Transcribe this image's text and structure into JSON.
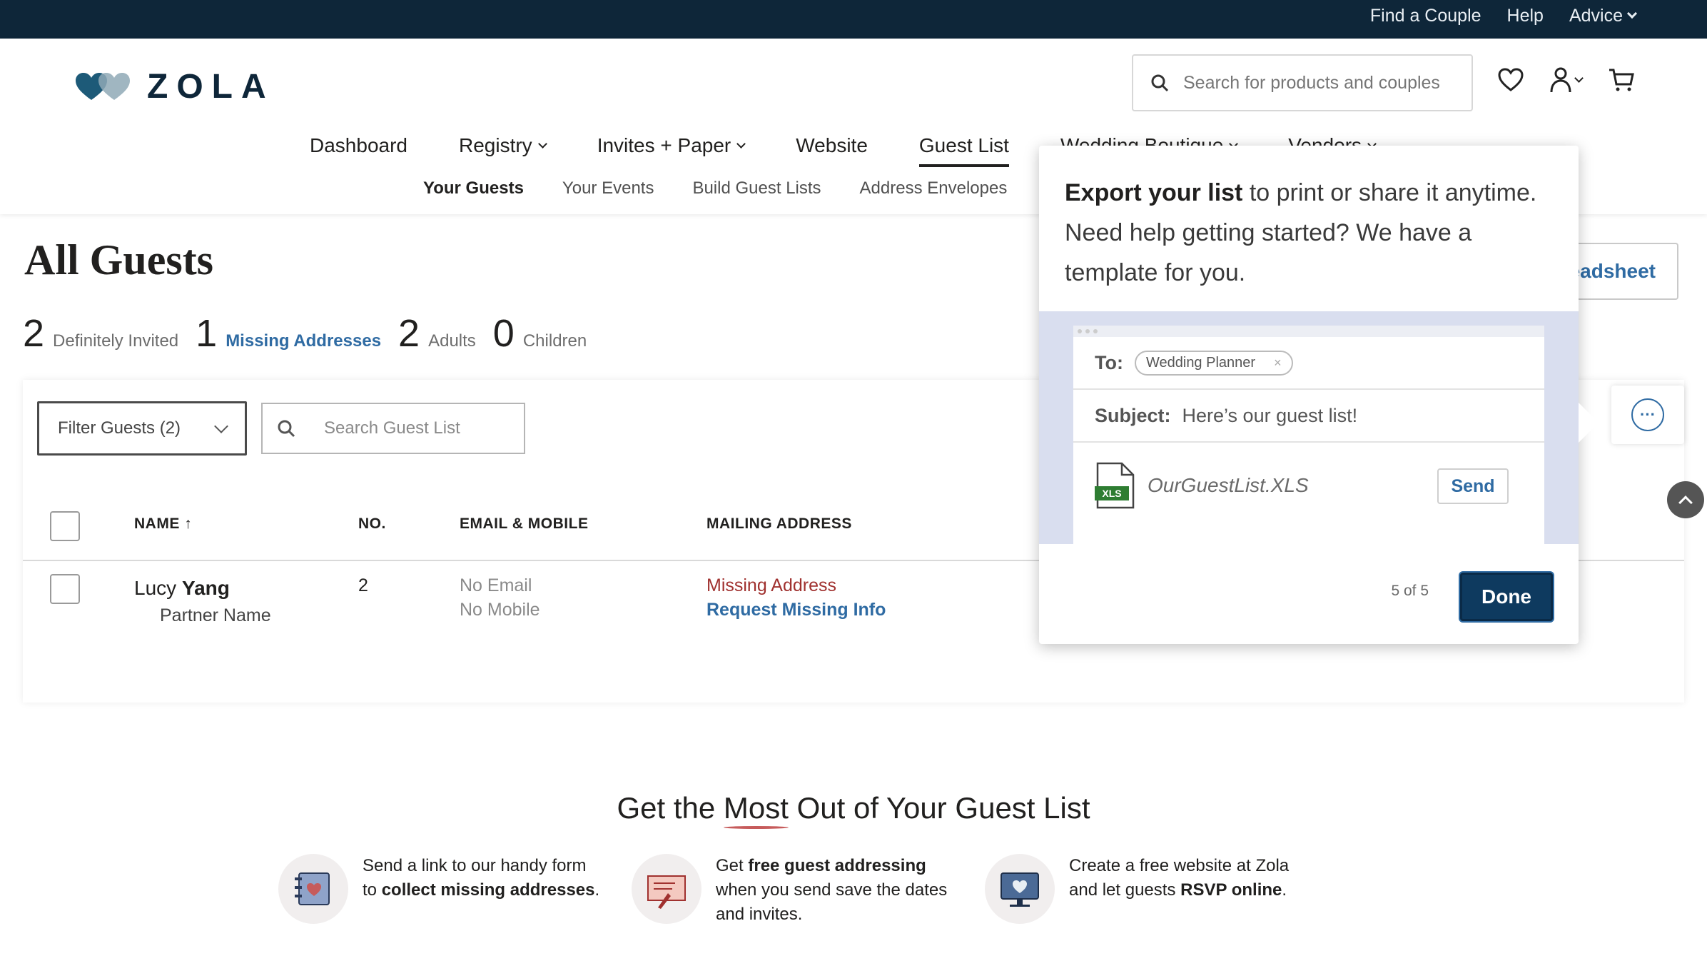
{
  "topbar": {
    "links": [
      {
        "label": "Find a Couple"
      },
      {
        "label": "Help"
      },
      {
        "label": "Advice"
      }
    ]
  },
  "header": {
    "logo_text": "ZOLA",
    "search_placeholder": "Search for products and couples",
    "nav": [
      {
        "label": "Dashboard"
      },
      {
        "label": "Registry"
      },
      {
        "label": "Invites + Paper"
      },
      {
        "label": "Website"
      },
      {
        "label": "Guest List"
      },
      {
        "label": "Wedding Boutique"
      },
      {
        "label": "Vendors"
      }
    ],
    "subnav": [
      {
        "label": "Your Guests"
      },
      {
        "label": "Your Events"
      },
      {
        "label": "Build Guest Lists"
      },
      {
        "label": "Address Envelopes"
      }
    ]
  },
  "page": {
    "title": "All Guests",
    "export_button_visible_text": "eadsheet",
    "stats": [
      {
        "num": "2",
        "label": "Definitely Invited"
      },
      {
        "num": "1",
        "label": "Missing Addresses"
      },
      {
        "num": "2",
        "label": "Adults"
      },
      {
        "num": "0",
        "label": "Children"
      }
    ]
  },
  "table": {
    "filter_label": "Filter Guests (2)",
    "search_placeholder": "Search Guest List",
    "headers": {
      "name": "NAME",
      "no": "NO.",
      "email": "EMAIL & MOBILE",
      "address": "MAILING ADDRESS"
    },
    "rows": [
      {
        "first": "Lucy",
        "last": "Yang",
        "partner": "Partner Name",
        "count": "2",
        "email": "No Email",
        "mobile": "No Mobile",
        "address_status": "Missing Address",
        "address_action": "Request Missing Info"
      }
    ]
  },
  "popover": {
    "bold_lead": "Export your list",
    "text_rest": " to print or share it anytime. Need help getting started? We have a template for you.",
    "illustration": {
      "to_label": "To:",
      "to_chip": "Wedding Planner",
      "chip_close": "×",
      "subject_label": "Subject:",
      "subject_value": "Here’s our guest list!",
      "file_badge": "XLS",
      "file_name": "OurGuestList.XLS",
      "send_label": "Send"
    },
    "counter": "5 of 5",
    "done_label": "Done"
  },
  "more_button": {
    "glyph": "···"
  },
  "promo": {
    "title_before": "Get the ",
    "title_underlined": "Most",
    "title_after": " Out of Your Guest List",
    "items": [
      {
        "t1": "Send a link to our handy form",
        "t2_plain": "to ",
        "t2_bold": "collect missing addresses",
        "t2_end": "."
      },
      {
        "t1_plain": "Get ",
        "t1_bold": "free guest addressing",
        "t2": "when you send save the dates",
        "t3": "and invites."
      },
      {
        "t1": "Create a free website at Zola",
        "t2_plain": "and let guests ",
        "t2_bold": "RSVP online",
        "t2_end": "."
      }
    ]
  },
  "colors": {
    "topbar": "#0e2639",
    "link_blue": "#2f6ba3",
    "missing_red": "#a0312f",
    "done_button": "#0e3a5f",
    "illustration_bg": "#d9deef"
  }
}
